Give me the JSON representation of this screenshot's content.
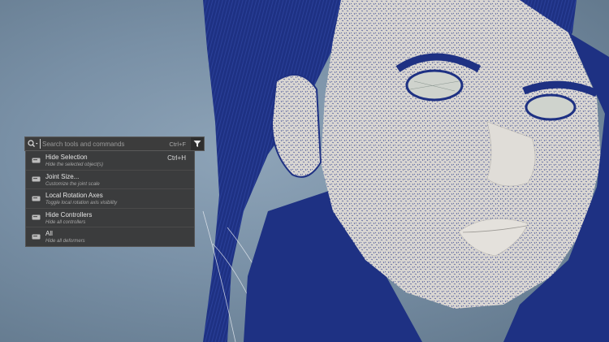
{
  "search": {
    "placeholder": "Search tools and commands",
    "shortcut": "Ctrl+F",
    "icon": "search-icon",
    "filter_icon": "filter-icon"
  },
  "results": [
    {
      "title": "Hide Selection",
      "description": "Hide the selected object(s)",
      "shortcut": "Ctrl+H"
    },
    {
      "title": "Joint Size...",
      "description": "Customize the joint scale",
      "shortcut": ""
    },
    {
      "title": "Local Rotation Axes",
      "description": "Toggle local rotation axis visibility",
      "shortcut": ""
    },
    {
      "title": "Hide Controllers",
      "description": "Hide all controllers",
      "shortcut": ""
    },
    {
      "title": "All",
      "description": "Hide all deformers",
      "shortcut": ""
    }
  ],
  "colors": {
    "wire_blue": "#1e3183",
    "mesh_gray": "#d9d6d2",
    "background": "#7990a6"
  }
}
